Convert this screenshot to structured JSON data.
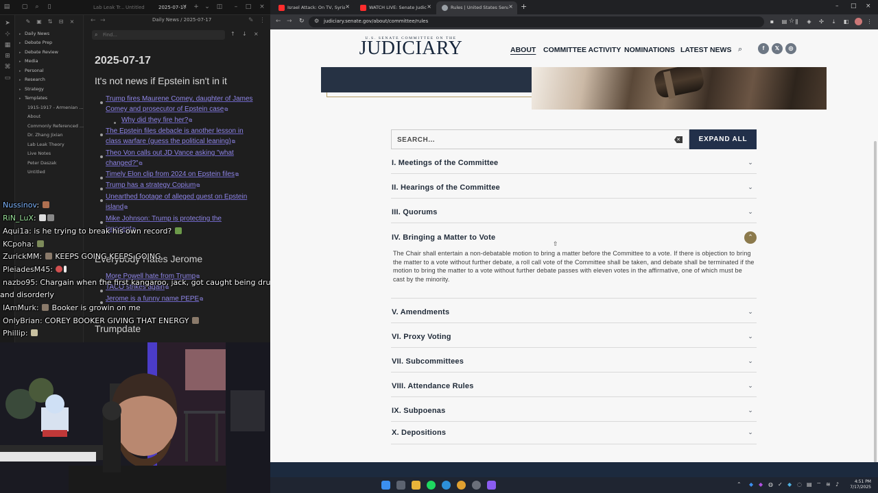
{
  "obsidian": {
    "tabs": [
      "Lab Leak Tr...",
      "Untitled",
      "2025-07-17"
    ],
    "breadcrumb": "Daily News / 2025-07-17",
    "find_placeholder": "Find...",
    "explorer_items": [
      "Daily News",
      "Debate Prep",
      "Debate Review",
      "Media",
      "Personal",
      "Research",
      "Strategy",
      "Templates"
    ],
    "explorer_files": [
      "1915-1917 - Armenian ...",
      "About",
      "Commonly Referenced ...",
      "Dr. Zhang Jixian",
      "Lab Leak Theory",
      "Live Notes",
      "Peter Daszak",
      "Untitled"
    ],
    "note_date": "2025-07-17",
    "note_heading": "It's not news if Epstein isn't in it",
    "links": [
      "Trump fires Maurene Comey, daughter of James",
      "Comey and prosecutor of Epstein case",
      "Why did they fire her?",
      "The Epstein files debacle is another lesson in",
      "class warfare (guess the political leaning)",
      "Theo Von calls out JD Vance asking \"what",
      "changed?\"",
      "Timely Elon clip from 2024 on Epstein files",
      "Trump has a strategy Copium",
      "Unearthed footage of alleged guest on Epstein",
      "island",
      "Mike Johnson: Trump is protecting the",
      "innocent"
    ],
    "heading2": "Everybody Hates Jerome",
    "links2": [
      "More Powell hate from Trump",
      "TACO strikes again",
      "Jerome is a funny name PEPE"
    ],
    "heading3": "Trumpdate"
  },
  "chat": [
    {
      "user": "Nussinov",
      "text": ""
    },
    {
      "user": "RiN_LuX",
      "text": ""
    },
    {
      "user": "Aqui1a",
      "text": "is he trying to break his own record?"
    },
    {
      "user": "KCpoha",
      "text": ""
    },
    {
      "user": "ZurickMM",
      "text": "KEEPS GOING KEEPS GOING"
    },
    {
      "user": "PleiadesM45",
      "text": ""
    },
    {
      "user": "nazbo95",
      "text": "Chargain when the first kangaroo, jack, got caught being drunk"
    },
    {
      "user": "",
      "text": "and disorderly"
    },
    {
      "user": "IAmMurk",
      "text": "Booker is growin on me"
    },
    {
      "user": "OnlyBrian",
      "text": "COREY BOOKER GIVING THAT ENERGY"
    },
    {
      "user": "Phillip",
      "text": ""
    }
  ],
  "browser": {
    "tabs": [
      {
        "title": "Israel Attack: On TV, Syria Repo",
        "color": "#ff2d2d"
      },
      {
        "title": "WATCH LIVE: Senate Judiciary C",
        "color": "#ff2d2d"
      },
      {
        "title": "Rules | United States Senate Co",
        "color": "#9aa0a6"
      }
    ],
    "url": "judiciary.senate.gov/about/committee/rules"
  },
  "site": {
    "logo_top": "U.S. SENATE COMMITTEE ON THE",
    "logo_main": "JUDICIARY",
    "nav": [
      "ABOUT",
      "COMMITTEE ACTIVITY",
      "NOMINATIONS",
      "LATEST NEWS"
    ],
    "social": [
      "f",
      "𝕏",
      "◎"
    ],
    "search_placeholder": "SEARCH...",
    "expand_all": "EXPAND ALL",
    "accent": "#8c7a4c",
    "navy": "#22304a"
  },
  "rules": [
    {
      "title": "I. Meetings of the Committee",
      "open": false
    },
    {
      "title": "II. Hearings of the Committee",
      "open": false
    },
    {
      "title": "III. Quorums",
      "open": false
    },
    {
      "title": "IV. Bringing a Matter to Vote",
      "open": true,
      "body": "The Chair shall entertain a non-debatable motion to bring a matter before the Committee to a vote. If there is objection to bring the matter to a vote without further debate, a roll call vote of the Committee shall be taken, and debate shall be terminated if the motion to bring the matter to a vote without further debate passes with eleven votes in the affirmative, one of which must be cast by the minority."
    },
    {
      "title": "V. Amendments",
      "open": false
    },
    {
      "title": "VI. Proxy Voting",
      "open": false
    },
    {
      "title": "VII. Subcommittees",
      "open": false
    },
    {
      "title": "VIII. Attendance Rules",
      "open": false
    },
    {
      "title": "IX. Subpoenas",
      "open": false
    },
    {
      "title": "X. Depositions",
      "open": false
    }
  ],
  "taskbar": {
    "time": "4:51 PM",
    "date": "7/17/2025"
  }
}
